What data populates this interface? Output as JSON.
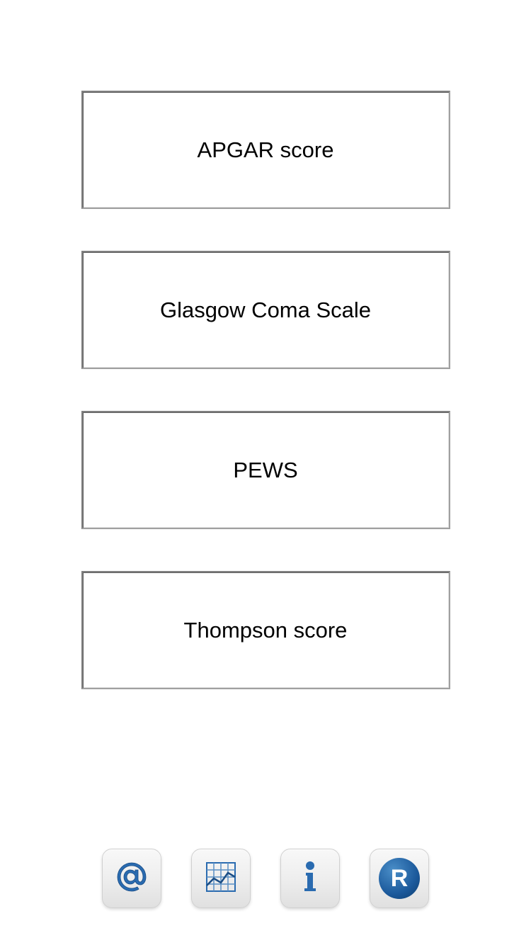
{
  "menu": {
    "items": [
      {
        "label": "APGAR score"
      },
      {
        "label": "Glasgow Coma Scale"
      },
      {
        "label": "PEWS"
      },
      {
        "label": "Thompson score"
      }
    ]
  },
  "toolbar": {
    "at_icon": "at-icon",
    "chart_icon": "chart-icon",
    "info_icon": "info-icon",
    "r_icon": "r-icon",
    "r_letter": "R"
  }
}
